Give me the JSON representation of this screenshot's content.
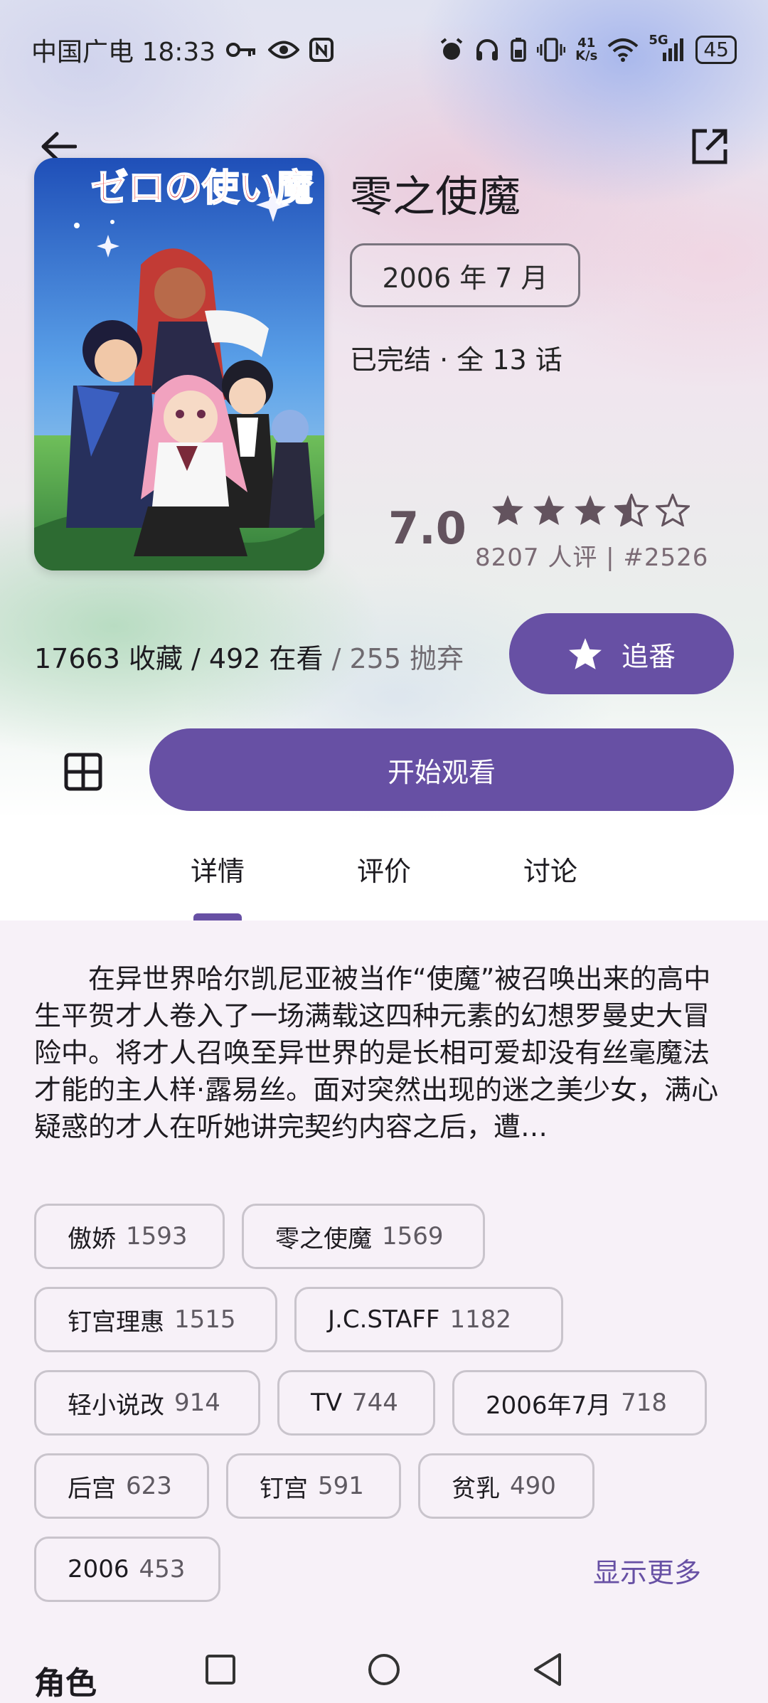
{
  "status_bar": {
    "carrier_time": "中国广电 18:33",
    "net_speed_top": "41",
    "net_speed_bottom": "K/s",
    "signal_type": "5G",
    "battery": "45",
    "icons": [
      "key-icon",
      "eye-icon",
      "nfc-icon",
      "alarm-icon",
      "headphones-icon",
      "battery-saver-icon",
      "vibrate-icon",
      "wifi-icon",
      "signal-icon"
    ]
  },
  "anime": {
    "title": "零之使魔",
    "air_date": "2006 年 7 月",
    "status": "已完结 · 全 13 话",
    "score": "7.0",
    "star_rating": 3.5,
    "rating_meta": "8207 人评 | #2526",
    "cover_text": "ゼロの使い魔"
  },
  "stats": {
    "main": "17663 收藏 / 492 在看",
    "dropped": " / 255 抛弃"
  },
  "buttons": {
    "follow": "追番",
    "watch": "开始观看"
  },
  "tabs": [
    "详情",
    "评价",
    "讨论"
  ],
  "synopsis": "在异世界哈尔凯尼亚被当作“使魔”被召唤出来的高中生平贺才人卷入了一场满载这四种元素的幻想罗曼史大冒险中。将才人召唤至异世界的是长相可爱却没有丝毫魔法才能的主人样·露易丝。面对突然出现的迷之美少女，满心疑惑的才人在听她讲完契约内容之后，遭…",
  "tags": [
    {
      "name": "傲娇",
      "count": "1593"
    },
    {
      "name": "零之使魔",
      "count": "1569"
    },
    {
      "name": "钉宫理惠",
      "count": "1515"
    },
    {
      "name": "J.C.STAFF",
      "count": "1182"
    },
    {
      "name": "轻小说改",
      "count": "914"
    },
    {
      "name": "TV",
      "count": "744"
    },
    {
      "name": "2006年7月",
      "count": "718"
    },
    {
      "name": "后宫",
      "count": "623"
    },
    {
      "name": "钉宫",
      "count": "591"
    },
    {
      "name": "贫乳",
      "count": "490"
    },
    {
      "name": "2006",
      "count": "453"
    }
  ],
  "show_more": "显示更多",
  "section_characters": "角色",
  "colors": {
    "primary": "#6750a4",
    "score": "#63535e"
  }
}
